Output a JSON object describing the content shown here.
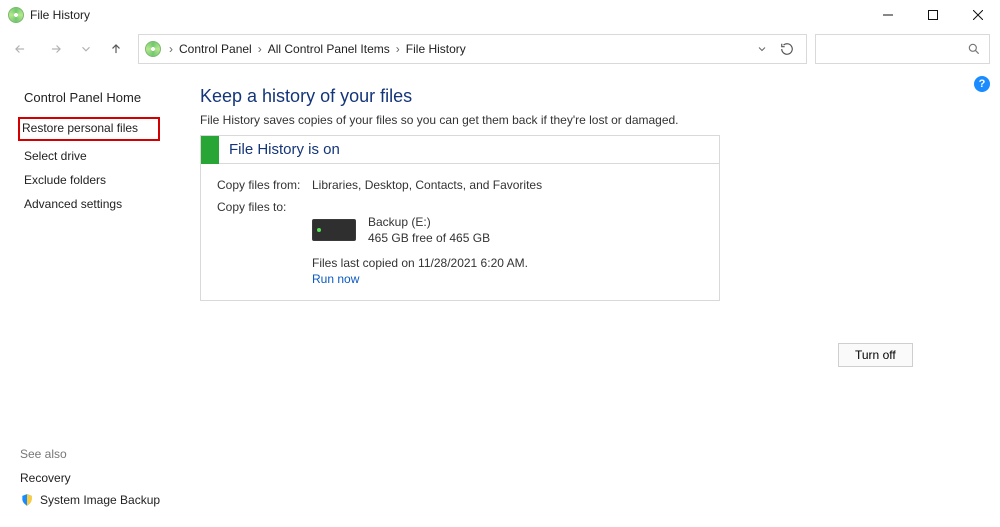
{
  "window": {
    "title": "File History"
  },
  "breadcrumbs": {
    "b0": "Control Panel",
    "b1": "All Control Panel Items",
    "b2": "File History"
  },
  "sidebar": {
    "home": "Control Panel Home",
    "links": {
      "restore": "Restore personal files",
      "select_drive": "Select drive",
      "exclude": "Exclude folders",
      "advanced": "Advanced settings"
    }
  },
  "see_also": {
    "title": "See also",
    "recovery": "Recovery",
    "backup": "System Image Backup"
  },
  "main": {
    "title": "Keep a history of your files",
    "description": "File History saves copies of your files so you can get them back if they're lost or damaged.",
    "status_title": "File History is on",
    "copy_from_label": "Copy files from:",
    "copy_from_value": "Libraries, Desktop, Contacts, and Favorites",
    "copy_to_label": "Copy files to:",
    "drive_name": "Backup (E:)",
    "drive_free": "465 GB free of 465 GB",
    "last_copied": "Files last copied on 11/28/2021 6:20 AM.",
    "run_now": "Run now",
    "turn_off": "Turn off"
  },
  "help": "?"
}
